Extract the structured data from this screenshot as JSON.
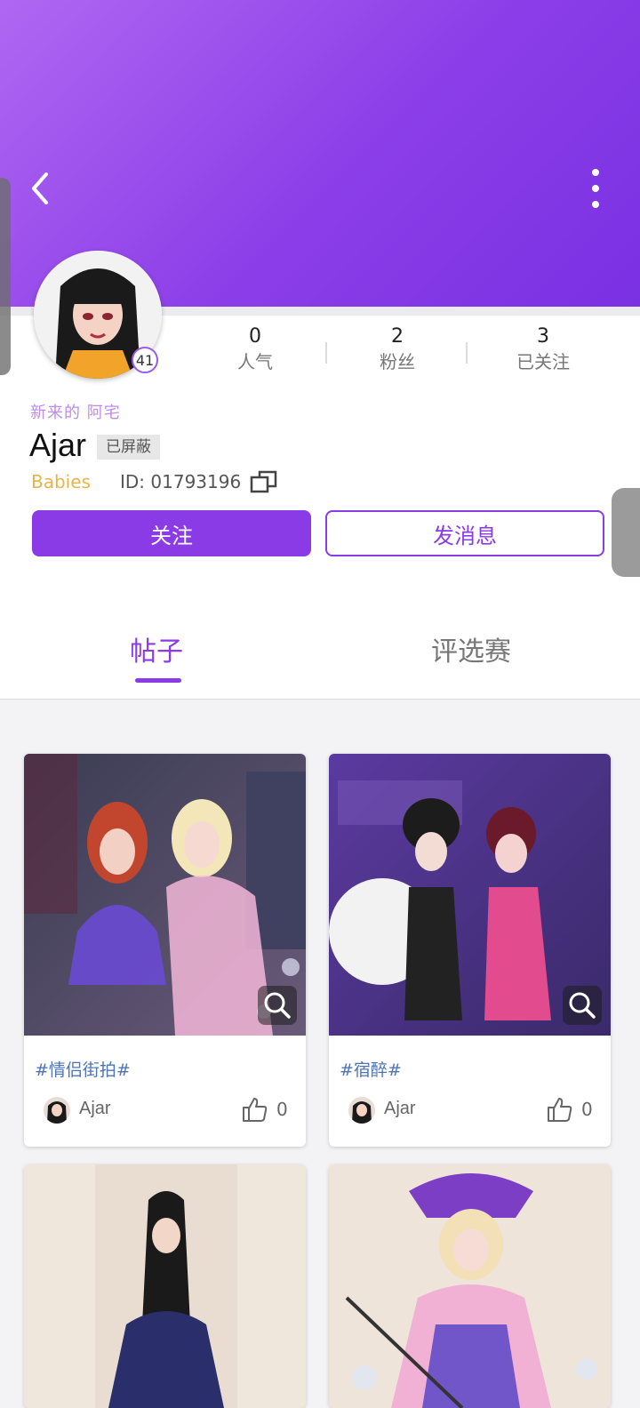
{
  "header": {
    "back_icon": "back-chevron-icon",
    "more_icon": "more-vertical-icon",
    "gradient": [
      "#b067f2",
      "#7a31e3"
    ]
  },
  "profile": {
    "level": "41",
    "titles": "新来的 阿宅",
    "username": "Ajar",
    "blocked_label": "已屏蔽",
    "club": "Babies",
    "id_text": "ID: 01793196",
    "stats": [
      {
        "value": "0",
        "label": "人气"
      },
      {
        "value": "2",
        "label": "粉丝"
      },
      {
        "value": "3",
        "label": "已关注"
      }
    ]
  },
  "actions": {
    "follow": "关注",
    "message": "发消息"
  },
  "tabs": [
    {
      "label": "帖子",
      "active": true
    },
    {
      "label": "评选赛",
      "active": false
    }
  ],
  "posts": [
    {
      "tag": "#情侣街拍#",
      "author": "Ajar",
      "likes": "0",
      "image": "two-dolls-street-neon"
    },
    {
      "tag": "#宿醉#",
      "author": "Ajar",
      "likes": "0",
      "image": "two-dolls-style-society"
    },
    {
      "tag": "",
      "author": "",
      "likes": "",
      "image": "doll-navy-jacket"
    },
    {
      "tag": "",
      "author": "",
      "likes": "",
      "image": "doll-purple-witch-hat"
    }
  ],
  "colors": {
    "accent": "#8a3be6",
    "tag_blue": "#4e74b8",
    "club_gold": "#e8b54a"
  }
}
